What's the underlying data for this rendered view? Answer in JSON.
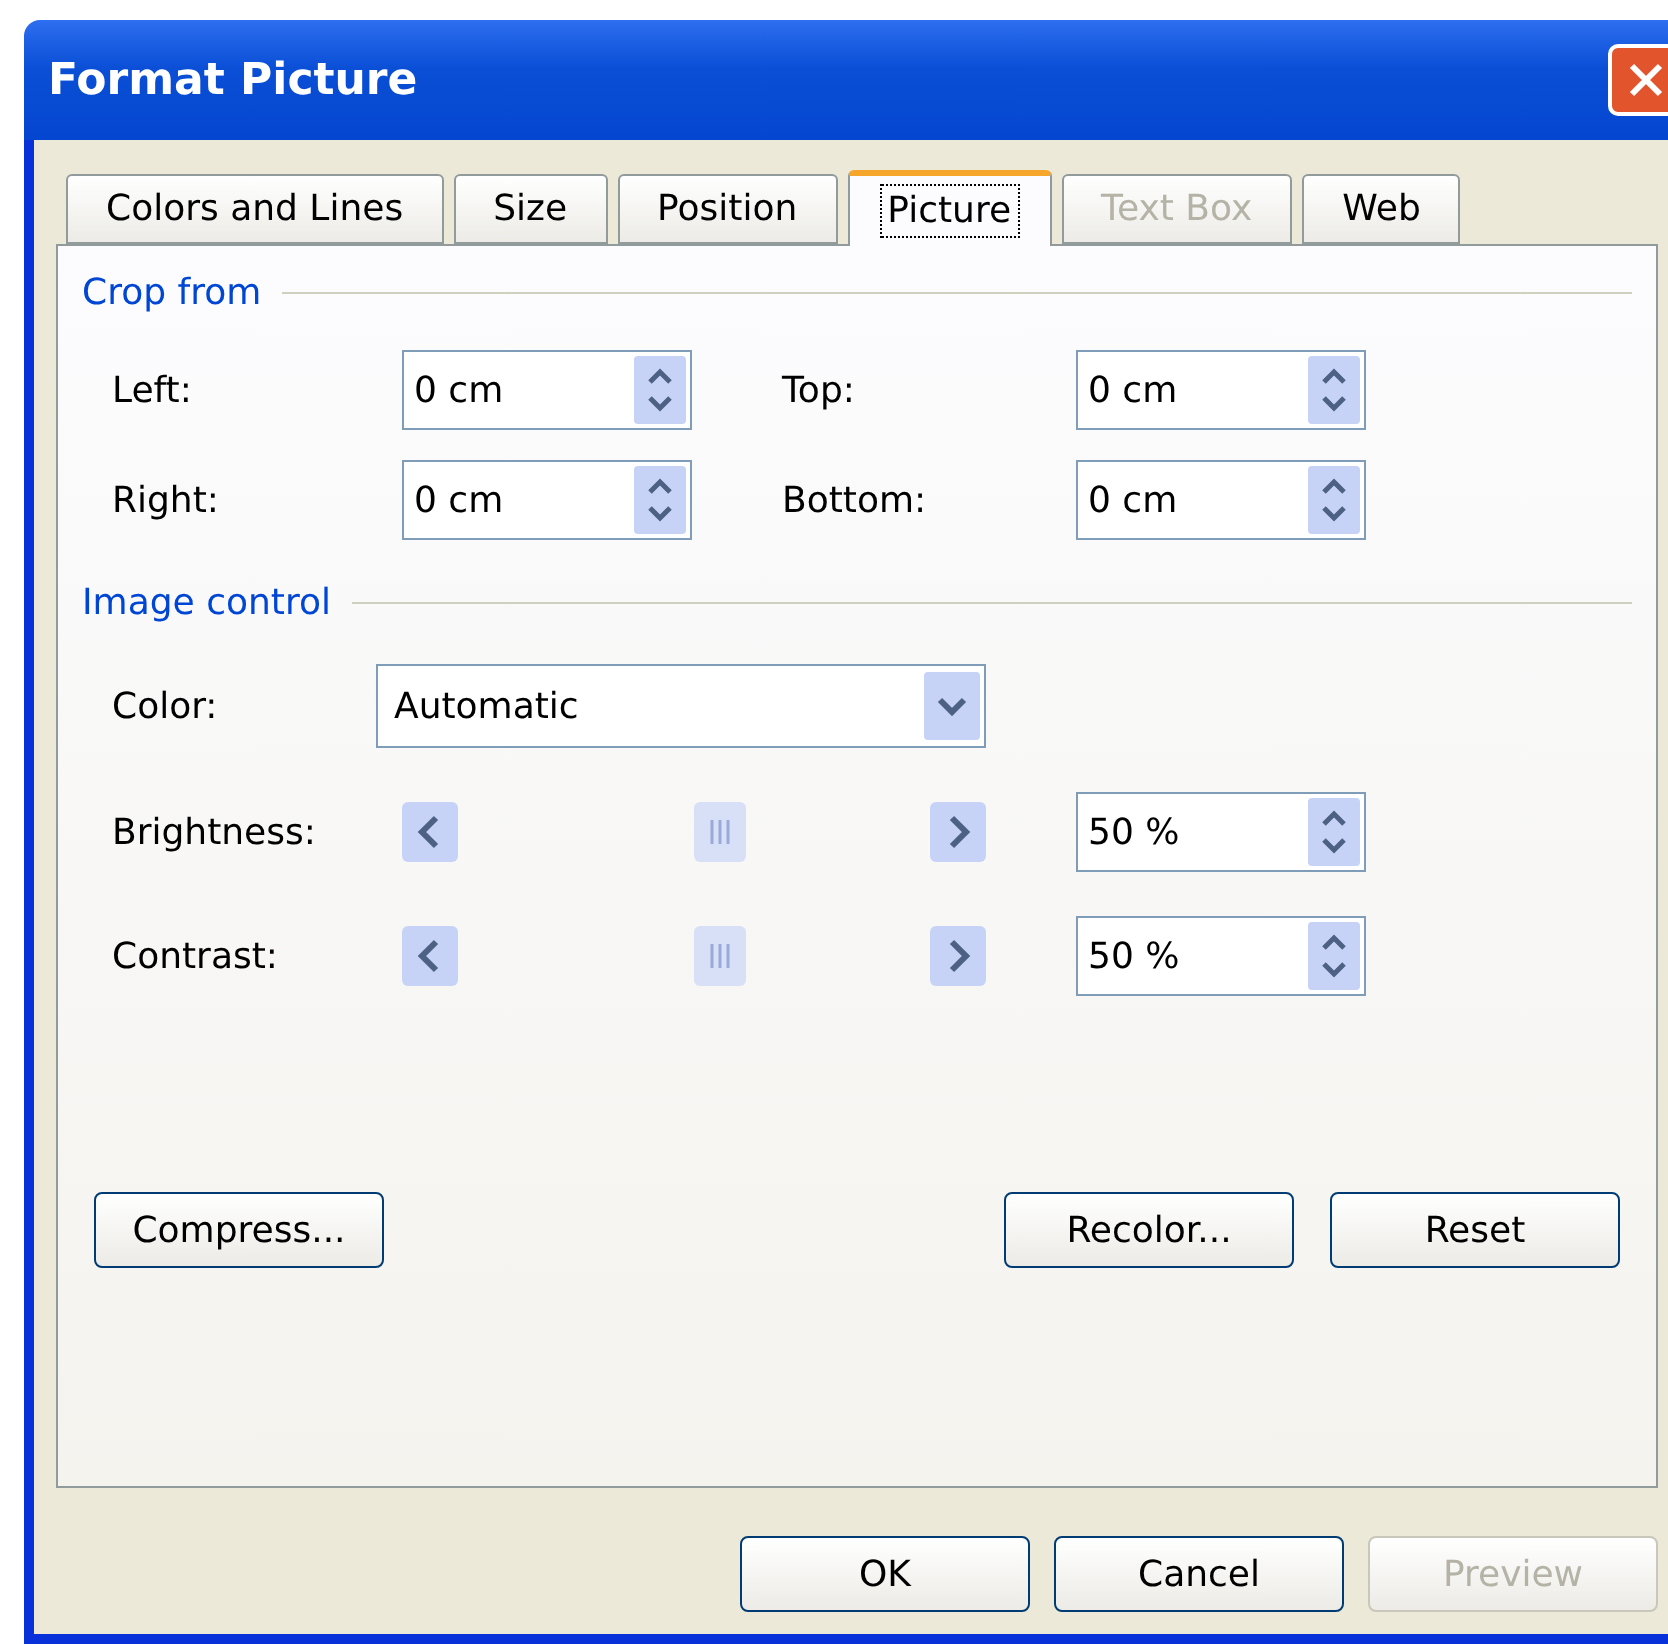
{
  "window": {
    "title": "Format Picture"
  },
  "tabs": [
    {
      "label": "Colors and Lines",
      "selected": false,
      "disabled": false
    },
    {
      "label": "Size",
      "selected": false,
      "disabled": false
    },
    {
      "label": "Position",
      "selected": false,
      "disabled": false
    },
    {
      "label": "Picture",
      "selected": true,
      "disabled": false
    },
    {
      "label": "Text Box",
      "selected": false,
      "disabled": true
    },
    {
      "label": "Web",
      "selected": false,
      "disabled": false
    }
  ],
  "crop_from": {
    "title": "Crop from",
    "fields": [
      {
        "label": "Left:",
        "value": "0 cm"
      },
      {
        "label": "Top:",
        "value": "0 cm"
      },
      {
        "label": "Right:",
        "value": "0 cm"
      },
      {
        "label": "Bottom:",
        "value": "0 cm"
      }
    ]
  },
  "image_control": {
    "title": "Image control",
    "color": {
      "label": "Color:",
      "value": "Automatic"
    },
    "sliders": [
      {
        "label": "Brightness:",
        "level": 0.5,
        "value": "50 %"
      },
      {
        "label": "Contrast:",
        "level": 0.5,
        "value": "50 %"
      }
    ]
  },
  "panel_buttons": [
    {
      "label": "Compress..."
    },
    {
      "label": "Recolor..."
    },
    {
      "label": "Reset"
    }
  ],
  "buttons": [
    {
      "label": "OK",
      "disabled": false
    },
    {
      "label": "Cancel",
      "disabled": false
    },
    {
      "label": "Preview",
      "disabled": true
    }
  ]
}
